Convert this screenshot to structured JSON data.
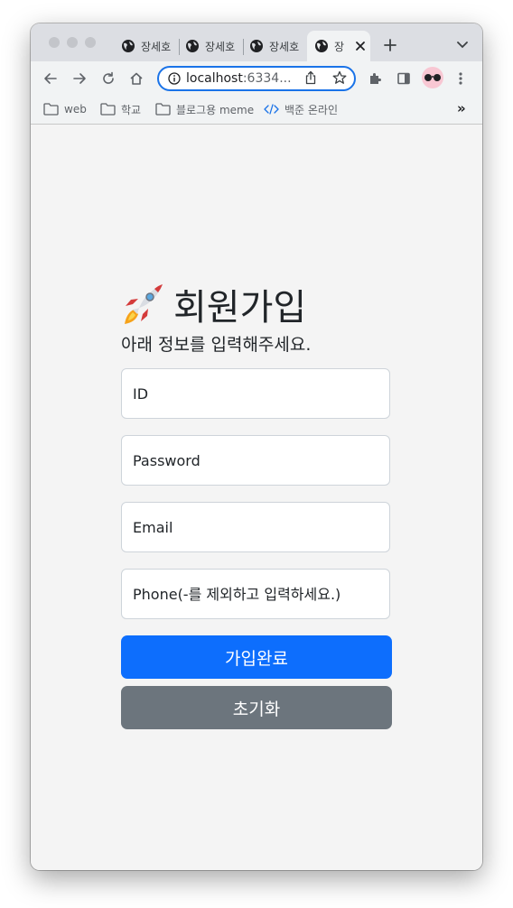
{
  "browser": {
    "tabs": [
      {
        "label": "장세호",
        "active": false
      },
      {
        "label": "장세호",
        "active": false
      },
      {
        "label": "장세호",
        "active": false
      },
      {
        "label": "장",
        "active": true
      }
    ],
    "new_tab_icon": "plus-icon",
    "tab_menu_icon": "chevron-down-icon",
    "url_host": "localhost",
    "url_rest": ":6334...",
    "bookmarks": [
      {
        "label": "web",
        "icon": "folder-icon"
      },
      {
        "label": "학교",
        "icon": "folder-icon"
      },
      {
        "label": "블로그용 meme",
        "icon": "folder-icon"
      },
      {
        "label": "백준 온라인",
        "icon": "code-icon"
      }
    ],
    "bookmarks_overflow": "»"
  },
  "page": {
    "heading_emoji": "rocket-icon",
    "heading": "회원가입",
    "subheading": "아래 정보를 입력해주세요.",
    "fields": {
      "id_placeholder": "ID",
      "password_placeholder": "Password",
      "email_placeholder": "Email",
      "phone_placeholder": "Phone(-를 제외하고 입력하세요.)"
    },
    "submit_label": "가입완료",
    "reset_label": "초기화"
  },
  "colors": {
    "primary": "#0d6efd",
    "secondary": "#6c757d",
    "background": "#f4f4f4",
    "omnibox_border": "#1a73e8"
  }
}
